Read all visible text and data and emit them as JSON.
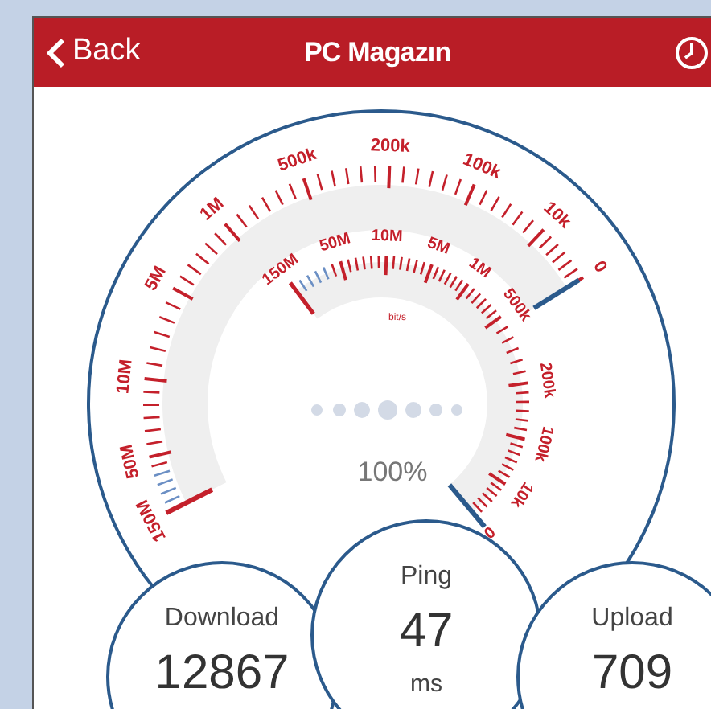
{
  "header": {
    "back_label": "Back",
    "title": "PC Magazın"
  },
  "gauge": {
    "outer_scale": [
      "0",
      "10k",
      "100k",
      "200k",
      "500k",
      "1M",
      "5M",
      "10M",
      "50M",
      "150M"
    ],
    "inner_scale": [
      "150M",
      "50M",
      "10M",
      "5M",
      "1M",
      "500k",
      "200k",
      "100k",
      "10k",
      "0"
    ],
    "unit": "bit/s",
    "progress": "100%"
  },
  "stats": [
    {
      "label": "Download",
      "value": "12867"
    },
    {
      "label": "Ping",
      "value": "47",
      "unit": "ms"
    },
    {
      "label": "Upload",
      "value": "709"
    }
  ]
}
